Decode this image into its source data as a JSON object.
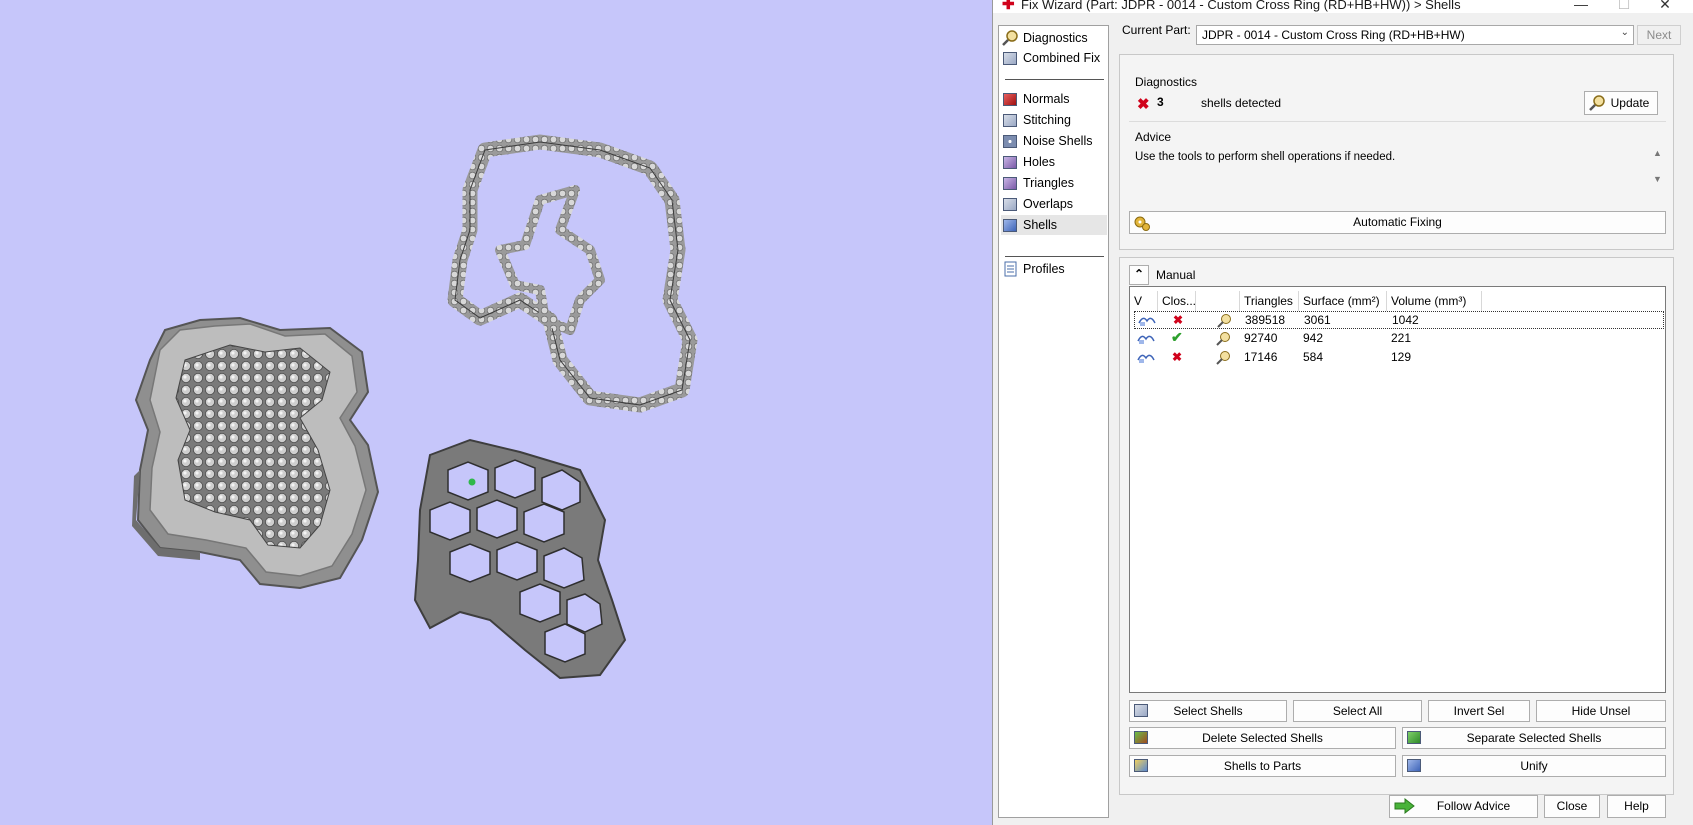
{
  "window": {
    "title": "Fix Wizard (Part: JDPR - 0014 - Custom Cross Ring (RD+HB+HW)) > Shells",
    "minimize": "—",
    "maximize": "☐",
    "close": "✕"
  },
  "nav": {
    "items": [
      {
        "label": "Diagnostics",
        "icon": "magnifier-icon"
      },
      {
        "label": "Combined Fix",
        "icon": "combined-fix-icon"
      },
      {
        "label": "Normals",
        "icon": "normals-icon"
      },
      {
        "label": "Stitching",
        "icon": "stitching-icon"
      },
      {
        "label": "Noise Shells",
        "icon": "noise-shells-icon"
      },
      {
        "label": "Holes",
        "icon": "holes-icon"
      },
      {
        "label": "Triangles",
        "icon": "triangles-icon"
      },
      {
        "label": "Overlaps",
        "icon": "overlaps-icon"
      },
      {
        "label": "Shells",
        "icon": "shells-icon",
        "selected": true
      },
      {
        "label": "Profiles",
        "icon": "profiles-icon"
      }
    ]
  },
  "header": {
    "current_part_label": "Current Part:",
    "current_part_value": "JDPR - 0014 - Custom Cross Ring (RD+HB+HW)",
    "next_label": "Next"
  },
  "diagnostics": {
    "title": "Diagnostics",
    "count": "3",
    "message": "shells detected",
    "update_label": "Update"
  },
  "advice": {
    "title": "Advice",
    "text": "Use the tools to perform shell operations if needed.",
    "automatic_fixing_label": "Automatic Fixing"
  },
  "manual": {
    "title": "Manual",
    "columns": [
      "V",
      "Clos...",
      "",
      "Triangles",
      "Surface (mm²)",
      "Volume (mm³)"
    ],
    "rows": [
      {
        "closed": false,
        "triangles": "389518",
        "surface": "3061",
        "volume": "1042",
        "selected": true
      },
      {
        "closed": true,
        "triangles": "92740",
        "surface": "942",
        "volume": "221"
      },
      {
        "closed": false,
        "triangles": "17146",
        "surface": "584",
        "volume": "129"
      }
    ],
    "buttons": {
      "select_shells": "Select Shells",
      "select_all": "Select All",
      "invert_sel": "Invert Sel",
      "hide_unsel": "Hide Unsel",
      "delete_selected": "Delete Selected Shells",
      "separate_selected": "Separate Selected Shells",
      "shells_to_parts": "Shells to Parts",
      "unify": "Unify"
    }
  },
  "footer": {
    "follow_advice": "Follow Advice",
    "close": "Close",
    "help": "Help"
  },
  "colors": {
    "viewport_bg": "#c6c6fa",
    "error_red": "#d0021b",
    "ok_green": "#2ca02c"
  }
}
